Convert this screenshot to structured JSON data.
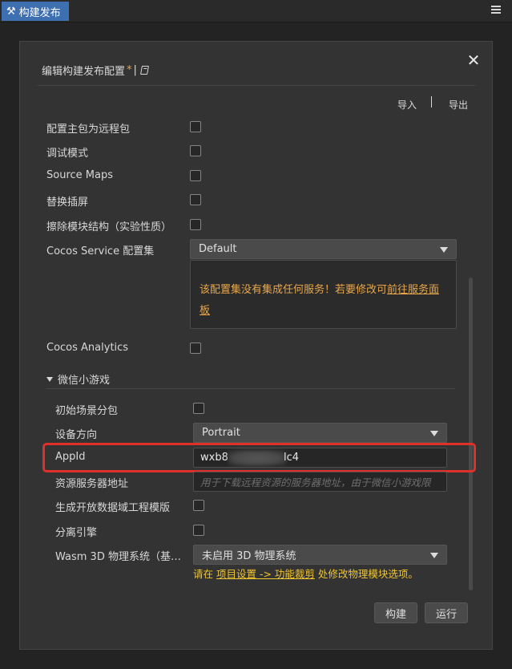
{
  "tab": {
    "label": "构建发布"
  },
  "dialog": {
    "title": "编辑构建发布配置",
    "modified_mark": "*",
    "separator": "|",
    "import_label": "导入",
    "io_separator": "|",
    "export_label": "导出"
  },
  "options": {
    "remote_main_bundle": "配置主包为远程包",
    "debug_mode": "调试模式",
    "source_maps": "Source Maps",
    "replace_splash": "替换插屏",
    "erase_module_structure": "擦除模块结构（实验性质）",
    "service_config_label": "Cocos Service 配置集",
    "service_config_value": "Default",
    "analytics": "Cocos Analytics"
  },
  "notice": {
    "text": "该配置集没有集成任何服务！若要修改可",
    "link": "前往服务面板"
  },
  "wechat": {
    "section_title": "微信小游戏",
    "initial_scene_subpackage": "初始场景分包",
    "orientation_label": "设备方向",
    "orientation_value": "Portrait",
    "appid_label": "AppId",
    "appid_prefix": "wxb8",
    "appid_suffix": "lc4",
    "remote_server_label": "资源服务器地址",
    "remote_server_placeholder": "用于下载远程资源的服务器地址，由于微信小游戏限",
    "open_data_context": "生成开放数据域工程模版",
    "separate_engine": "分离引擎",
    "wasm_label": "Wasm 3D 物理系统（基…",
    "wasm_value": "未启用 3D 物理系统",
    "hint_prefix": "请在",
    "hint_link": "项目设置 -> 功能裁剪",
    "hint_suffix": "处修改物理模块选项。"
  },
  "buttons": {
    "build": "构建",
    "run": "运行"
  },
  "colors": {
    "accent_tab": "#3d6fb1",
    "warning": "#e8a64a",
    "hint": "#f0c42e",
    "highlight": "#e0302a"
  }
}
